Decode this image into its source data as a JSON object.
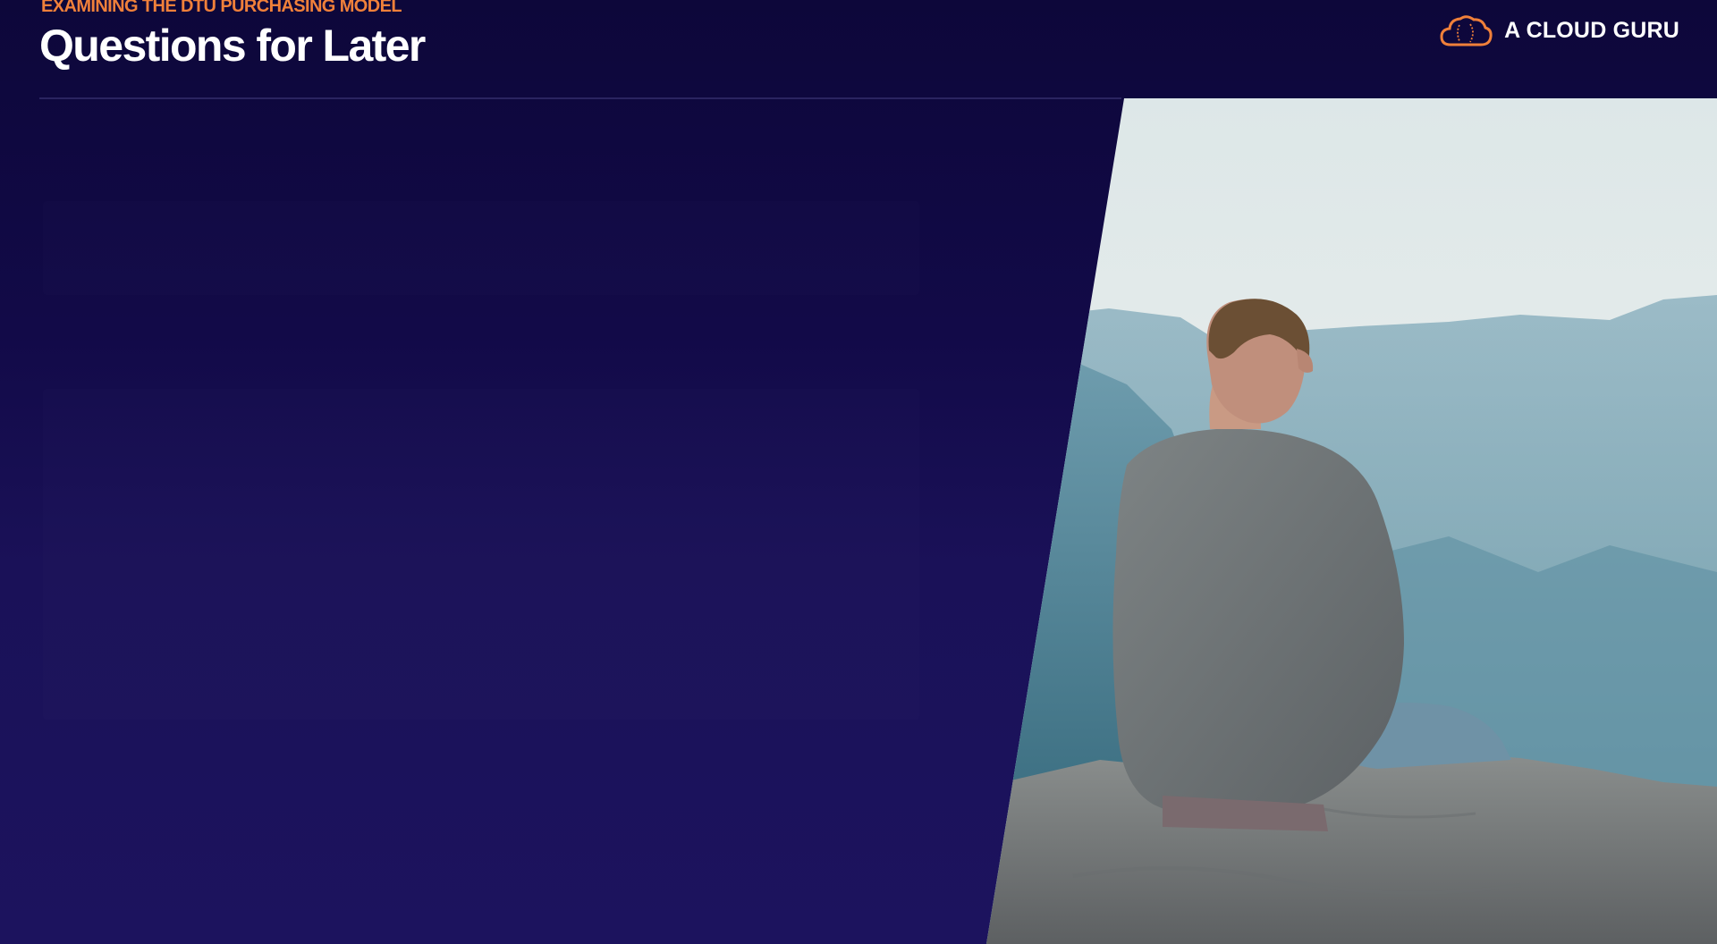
{
  "slide": {
    "eyebrow": "EXAMINING THE DTU PURCHASING MODEL",
    "title": "Questions for Later"
  },
  "brand": {
    "name": "A CLOUD GURU",
    "icon": "cloud-logo-icon",
    "accent_color": "#f0803a"
  },
  "image": {
    "subject": "person-sitting-on-cliff-icon"
  },
  "colors": {
    "background_top": "#0d073a",
    "background_bottom": "#1c135e",
    "accent": "#f0803a"
  }
}
